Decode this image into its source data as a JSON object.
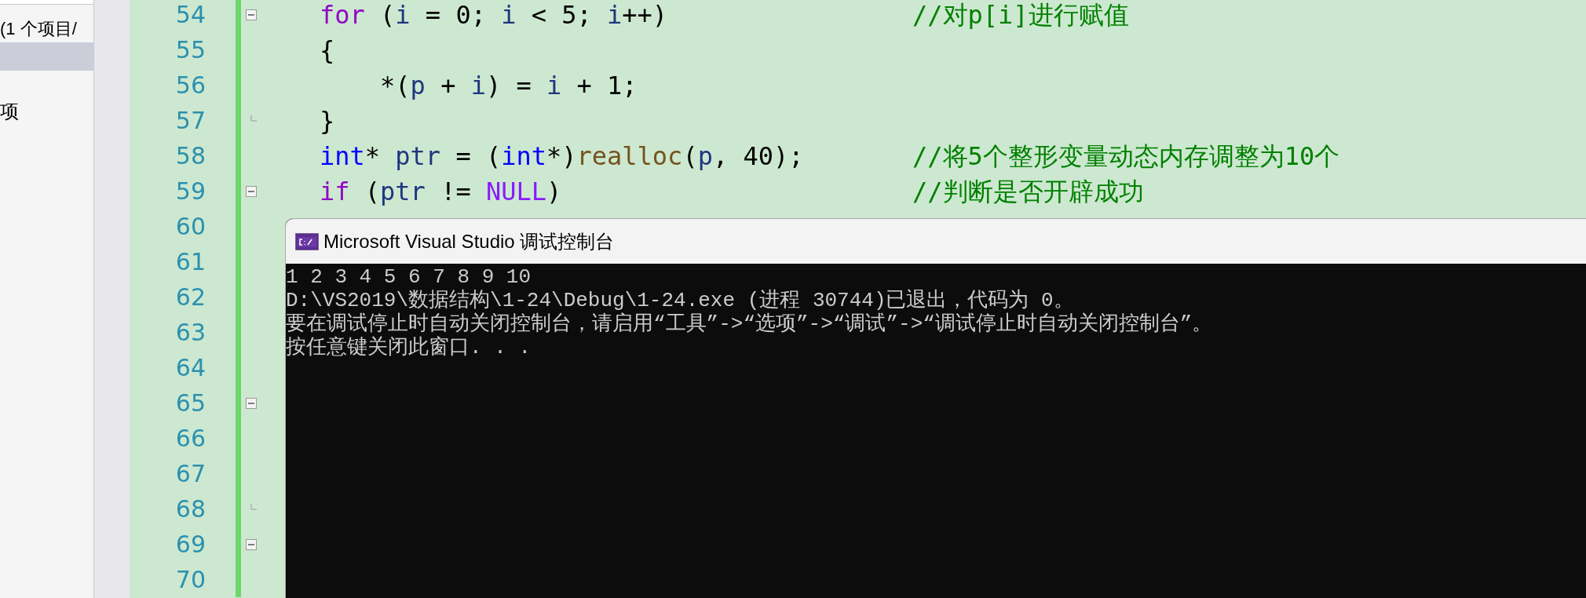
{
  "sidebar": {
    "header": "(1 个项目/",
    "items": [
      {
        "selected": true
      },
      {
        "label": "项",
        "selected": false
      }
    ]
  },
  "editor": {
    "lines": [
      {
        "number": "54",
        "collapsible": true,
        "code": [
          {
            "t": "for",
            "kind": "control"
          },
          {
            "t": " (",
            "kind": "plain"
          },
          {
            "t": "i",
            "kind": "var"
          },
          {
            "t": " = 0; ",
            "kind": "plain"
          },
          {
            "t": "i",
            "kind": "var"
          },
          {
            "t": " < 5; ",
            "kind": "plain"
          },
          {
            "t": "i",
            "kind": "var"
          },
          {
            "t": "++)",
            "kind": "plain"
          }
        ],
        "comment": "//对p[i]进行赋值"
      },
      {
        "number": "55",
        "code": [
          {
            "t": "{",
            "kind": "plain"
          }
        ]
      },
      {
        "number": "56",
        "code": [
          {
            "t": "    *(",
            "kind": "plain"
          },
          {
            "t": "p",
            "kind": "var"
          },
          {
            "t": " + ",
            "kind": "plain"
          },
          {
            "t": "i",
            "kind": "var"
          },
          {
            "t": ") = ",
            "kind": "plain"
          },
          {
            "t": "i",
            "kind": "var"
          },
          {
            "t": " + 1;",
            "kind": "plain"
          }
        ]
      },
      {
        "number": "57",
        "block_end": true,
        "code": [
          {
            "t": "}",
            "kind": "plain"
          }
        ]
      },
      {
        "number": "58",
        "code": [
          {
            "t": "int",
            "kind": "keyword"
          },
          {
            "t": "* ",
            "kind": "plain"
          },
          {
            "t": "ptr",
            "kind": "var"
          },
          {
            "t": " = (",
            "kind": "plain"
          },
          {
            "t": "int",
            "kind": "keyword"
          },
          {
            "t": "*)",
            "kind": "plain"
          },
          {
            "t": "realloc",
            "kind": "func"
          },
          {
            "t": "(",
            "kind": "plain"
          },
          {
            "t": "p",
            "kind": "var"
          },
          {
            "t": ", 40);",
            "kind": "plain"
          }
        ],
        "comment": "//将5个整形变量动态内存调整为10个"
      },
      {
        "number": "59",
        "collapsible": true,
        "code": [
          {
            "t": "if",
            "kind": "control"
          },
          {
            "t": " (",
            "kind": "plain"
          },
          {
            "t": "ptr",
            "kind": "var"
          },
          {
            "t": " != ",
            "kind": "plain"
          },
          {
            "t": "NULL",
            "kind": "macro"
          },
          {
            "t": ")",
            "kind": "plain"
          }
        ],
        "comment": "//判断是否开辟成功"
      },
      {
        "number": "60"
      },
      {
        "number": "61"
      },
      {
        "number": "62"
      },
      {
        "number": "63"
      },
      {
        "number": "64"
      },
      {
        "number": "65",
        "collapsible": true
      },
      {
        "number": "66"
      },
      {
        "number": "67"
      },
      {
        "number": "68",
        "block_end": true
      },
      {
        "number": "69",
        "collapsible": true
      },
      {
        "number": "70"
      }
    ]
  },
  "console": {
    "title": "Microsoft Visual Studio 调试控制台",
    "output": [
      "1 2 3 4 5 6 7 8 9 10",
      "D:\\VS2019\\数据结构\\1-24\\Debug\\1-24.exe (进程 30744)已退出，代码为 0。",
      "要在调试停止时自动关闭控制台，请启用“工具”->“选项”->“调试”->“调试停止时自动关闭控制台”。",
      "按任意键关闭此窗口. . ."
    ]
  }
}
